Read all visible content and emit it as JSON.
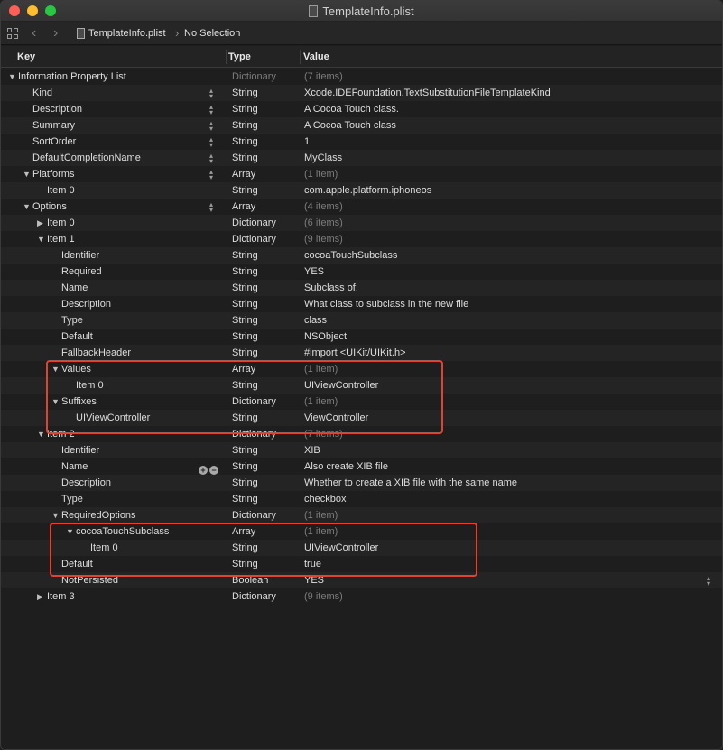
{
  "window": {
    "title": "TemplateInfo.plist"
  },
  "jumpbar": {
    "file": "TemplateInfo.plist",
    "selection": "No Selection"
  },
  "columns": {
    "key": "Key",
    "type": "Type",
    "value": "Value"
  },
  "rows": [
    {
      "key": "Information Property List",
      "type": "Dictionary",
      "value": "(7 items)",
      "level": 0,
      "disclosure": "open",
      "dim_type": true,
      "dim_value": true
    },
    {
      "key": "Kind",
      "type": "String",
      "value": "Xcode.IDEFoundation.TextSubstitutionFileTemplateKind",
      "level": 1,
      "stepper": true
    },
    {
      "key": "Description",
      "type": "String",
      "value": "A Cocoa Touch class.",
      "level": 1,
      "stepper": true
    },
    {
      "key": "Summary",
      "type": "String",
      "value": "A Cocoa Touch class",
      "level": 1,
      "stepper": true
    },
    {
      "key": "SortOrder",
      "type": "String",
      "value": "1",
      "level": 1,
      "stepper": true
    },
    {
      "key": "DefaultCompletionName",
      "type": "String",
      "value": "MyClass",
      "level": 1,
      "stepper": true
    },
    {
      "key": "Platforms",
      "type": "Array",
      "value": "(1 item)",
      "level": 1,
      "disclosure": "open",
      "stepper": true,
      "dim_value": true
    },
    {
      "key": "Item 0",
      "type": "String",
      "value": "com.apple.platform.iphoneos",
      "level": 2
    },
    {
      "key": "Options",
      "type": "Array",
      "value": "(4 items)",
      "level": 1,
      "disclosure": "open",
      "stepper": true,
      "dim_value": true
    },
    {
      "key": "Item 0",
      "type": "Dictionary",
      "value": "(6 items)",
      "level": 2,
      "disclosure": "closed",
      "dim_value": true
    },
    {
      "key": "Item 1",
      "type": "Dictionary",
      "value": "(9 items)",
      "level": 2,
      "disclosure": "open",
      "dim_value": true
    },
    {
      "key": "Identifier",
      "type": "String",
      "value": "cocoaTouchSubclass",
      "level": 3
    },
    {
      "key": "Required",
      "type": "String",
      "value": "YES",
      "level": 3
    },
    {
      "key": "Name",
      "type": "String",
      "value": "Subclass of:",
      "level": 3
    },
    {
      "key": "Description",
      "type": "String",
      "value": "What class to subclass in the new file",
      "level": 3
    },
    {
      "key": "Type",
      "type": "String",
      "value": "class",
      "level": 3
    },
    {
      "key": "Default",
      "type": "String",
      "value": "NSObject",
      "level": 3
    },
    {
      "key": "FallbackHeader",
      "type": "String",
      "value": "#import <UIKit/UIKit.h>",
      "level": 3
    },
    {
      "key": "Values",
      "type": "Array",
      "value": "(1 item)",
      "level": 3,
      "disclosure": "open",
      "dim_value": true
    },
    {
      "key": "Item 0",
      "type": "String",
      "value": "UIViewController",
      "level": 4
    },
    {
      "key": "Suffixes",
      "type": "Dictionary",
      "value": "(1 item)",
      "level": 3,
      "disclosure": "open",
      "dim_value": true
    },
    {
      "key": "UIViewController",
      "type": "String",
      "value": "ViewController",
      "level": 4
    },
    {
      "key": "Item 2",
      "type": "Dictionary",
      "value": "(7 items)",
      "level": 2,
      "disclosure": "open",
      "dim_value": true
    },
    {
      "key": "Identifier",
      "type": "String",
      "value": "XIB",
      "level": 3
    },
    {
      "key": "Name",
      "type": "String",
      "value": "Also create XIB file",
      "level": 3,
      "addremove": true
    },
    {
      "key": "Description",
      "type": "String",
      "value": "Whether to create a XIB file with the same name",
      "level": 3
    },
    {
      "key": "Type",
      "type": "String",
      "value": "checkbox",
      "level": 3
    },
    {
      "key": "RequiredOptions",
      "type": "Dictionary",
      "value": "(1 item)",
      "level": 3,
      "disclosure": "open",
      "dim_value": true
    },
    {
      "key": "cocoaTouchSubclass",
      "type": "Array",
      "value": "(1 item)",
      "level": 4,
      "disclosure": "open",
      "dim_value": true
    },
    {
      "key": "Item 0",
      "type": "String",
      "value": "UIViewController",
      "level": 5
    },
    {
      "key": "Default",
      "type": "String",
      "value": "true",
      "level": 3
    },
    {
      "key": "NotPersisted",
      "type": "Boolean",
      "value": "YES",
      "level": 3,
      "stepper_right": true
    },
    {
      "key": "Item 3",
      "type": "Dictionary",
      "value": "(9 items)",
      "level": 2,
      "disclosure": "closed",
      "dim_value": true
    }
  ],
  "colors": {
    "highlight": "#e0432f",
    "background": "#1e1e1e"
  }
}
